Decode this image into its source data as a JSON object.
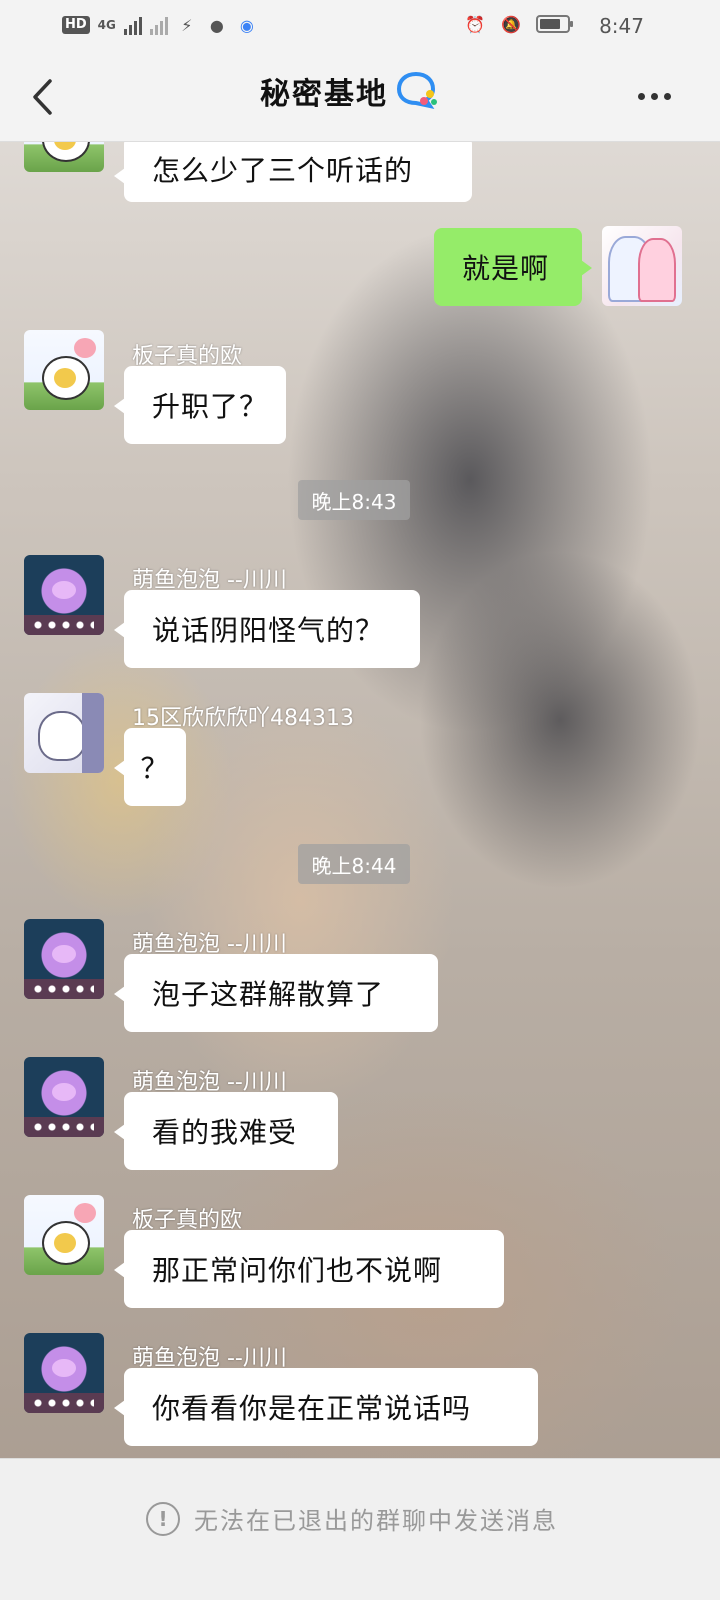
{
  "status_bar": {
    "hd_label": "HD",
    "network_label": "4G",
    "time": "8:47"
  },
  "header": {
    "title": "秘密基地"
  },
  "messages": [
    {
      "type": "text",
      "side": "left",
      "avatar": "egg-icon",
      "sender": "",
      "text": "怎么少了三个听话的"
    },
    {
      "type": "text",
      "side": "right",
      "avatar": "pinkgirl-icon",
      "sender": "",
      "text": "就是啊"
    },
    {
      "type": "text",
      "side": "left",
      "avatar": "egg-icon",
      "sender": "板子真的欧",
      "text": "升职了？"
    },
    {
      "type": "time",
      "text": "晚上8:43"
    },
    {
      "type": "text",
      "side": "left",
      "avatar": "jelly-icon",
      "sender": "萌鱼泡泡 --川川",
      "text": "说话阴阳怪气的？"
    },
    {
      "type": "text",
      "side": "left",
      "avatar": "anime-icon",
      "sender": "15区欣欣欣吖484313",
      "text": "？"
    },
    {
      "type": "time",
      "text": "晚上8:44"
    },
    {
      "type": "text",
      "side": "left",
      "avatar": "jelly-icon",
      "sender": "萌鱼泡泡 --川川",
      "text": "泡子这群解散算了"
    },
    {
      "type": "text",
      "side": "left",
      "avatar": "jelly-icon",
      "sender": "萌鱼泡泡 --川川",
      "text": "看的我难受"
    },
    {
      "type": "text",
      "side": "left",
      "avatar": "egg-icon",
      "sender": "板子真的欧",
      "text": "那正常问你们也不说啊"
    },
    {
      "type": "text",
      "side": "left",
      "avatar": "jelly-icon",
      "sender": "萌鱼泡泡 --川川",
      "text": "你看看你是在正常说话吗"
    }
  ],
  "footer": {
    "notice": "无法在已退出的群聊中发送消息"
  },
  "colors": {
    "my_bubble": "#95ec69",
    "other_bubble": "#ffffff",
    "header_bg": "#f3f3f3"
  }
}
